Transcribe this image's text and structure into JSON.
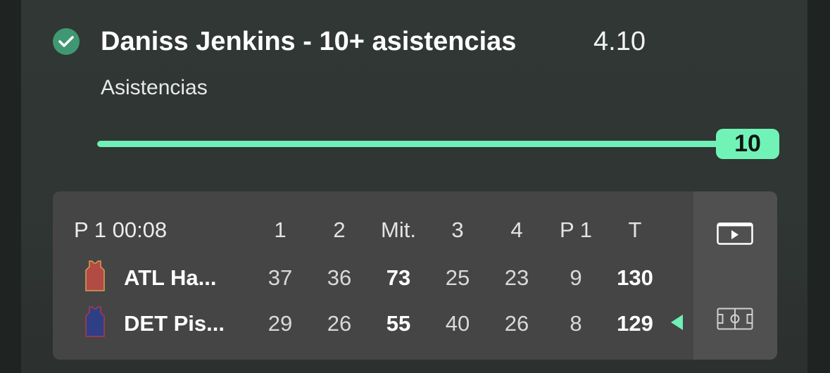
{
  "bet": {
    "title": "Daniss Jenkins - 10+ asistencias",
    "odds": "4.10",
    "stat_label": "Asistencias",
    "progress_value": "10",
    "progress_fraction": 1.0
  },
  "scoreboard": {
    "clock": "P 1 00:08",
    "columns": [
      "1",
      "2",
      "Mit.",
      "3",
      "4",
      "P 1",
      "T"
    ],
    "teams": [
      {
        "name": "ATL Ha...",
        "jersey_color": "#b24a45",
        "scores": [
          "37",
          "36",
          "73",
          "25",
          "23",
          "9",
          "130"
        ]
      },
      {
        "name": "DET Pis...",
        "jersey_color": "#2e3f86",
        "scores": [
          "29",
          "26",
          "55",
          "40",
          "26",
          "8",
          "129"
        ],
        "possession": true
      }
    ]
  },
  "icons": {
    "check": "check-circle-icon",
    "video": "play-video-icon",
    "court": "court-icon"
  },
  "colors": {
    "accent": "#6ff0b5",
    "check": "#3f9872"
  }
}
